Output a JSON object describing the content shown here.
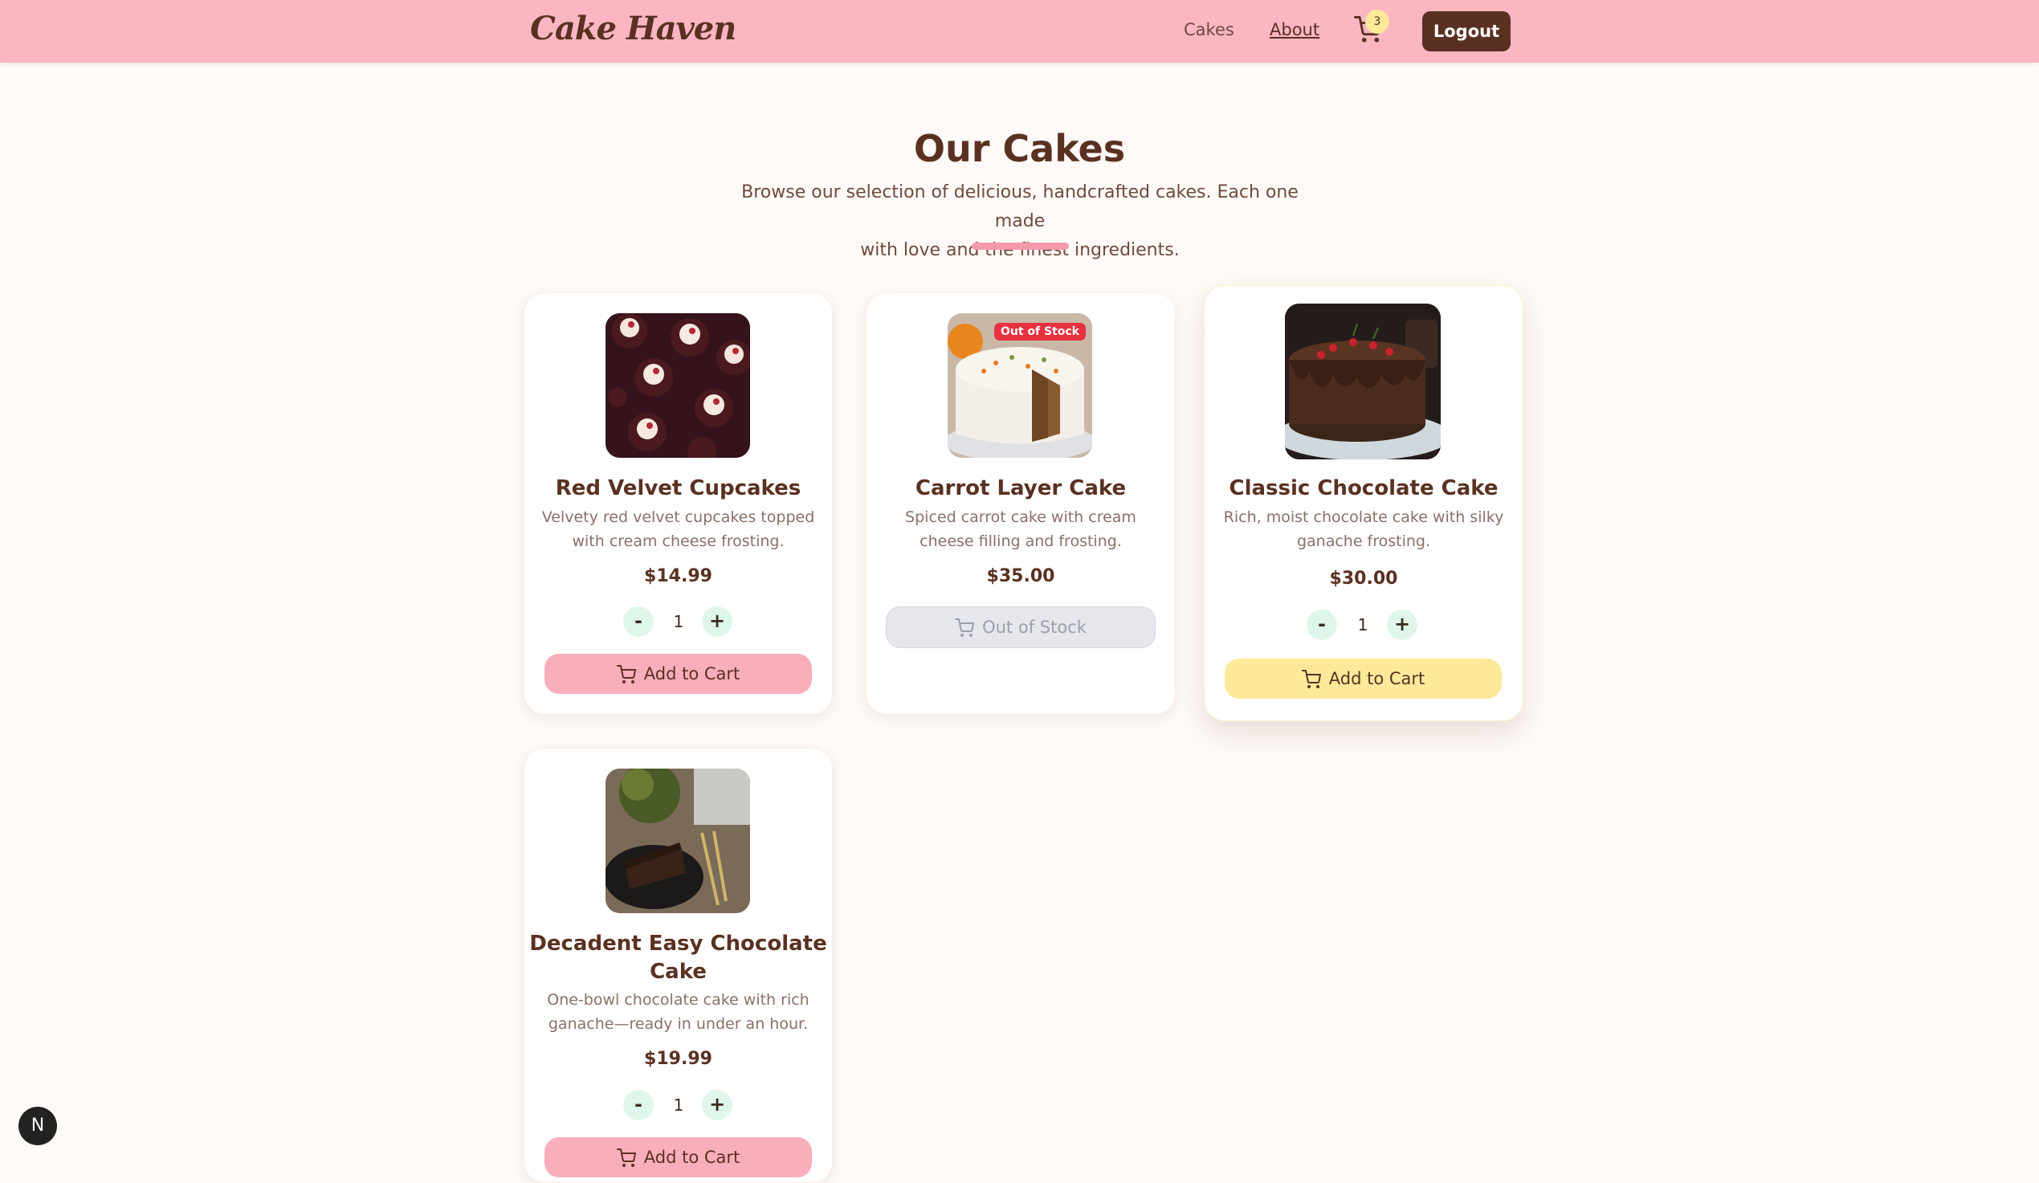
{
  "header": {
    "logo": "Cake Haven",
    "nav": {
      "cakes": "Cakes",
      "about": "About"
    },
    "cart_count": "3",
    "logout": "Logout",
    "accent_color": "#fbb6c2"
  },
  "hero": {
    "title": "Our Cakes",
    "subtitle_line1": "Browse our selection of delicious, handcrafted cakes. Each one made",
    "subtitle_line2": "with love and the finest ingredients."
  },
  "products": [
    {
      "name": "Red Velvet Cupcakes",
      "desc_line1": "Velvety red velvet cupcakes topped",
      "desc_line2": "with cream cheese frosting.",
      "price": "$14.99",
      "qty": "1",
      "button": "Add to Cart",
      "image": "cupcakes-image"
    },
    {
      "name": "Carrot Layer Cake",
      "desc_line1": "Spiced carrot cake with cream",
      "desc_line2": "cheese filling and frosting.",
      "price": "$35.00",
      "badge": "Out of Stock",
      "button": "Out of Stock",
      "image": "carrot-cake-image"
    },
    {
      "name": "Classic Chocolate Cake",
      "desc_line1": "Rich, moist chocolate cake with silky",
      "desc_line2": "ganache frosting.",
      "price": "$30.00",
      "qty": "1",
      "button": "Add to Cart",
      "image": "chocolate-cake-image"
    },
    {
      "name_line1": "Decadent Easy Chocolate",
      "name_line2": "Cake",
      "desc_line1": "One-bowl chocolate cake with rich",
      "desc_line2": "ganache—ready in under an hour.",
      "price": "$19.99",
      "qty": "1",
      "button": "Add to Cart",
      "image": "chocolate-slice-image"
    }
  ],
  "qty_labels": {
    "minus": "-",
    "plus": "+"
  },
  "dev_badge": "N"
}
